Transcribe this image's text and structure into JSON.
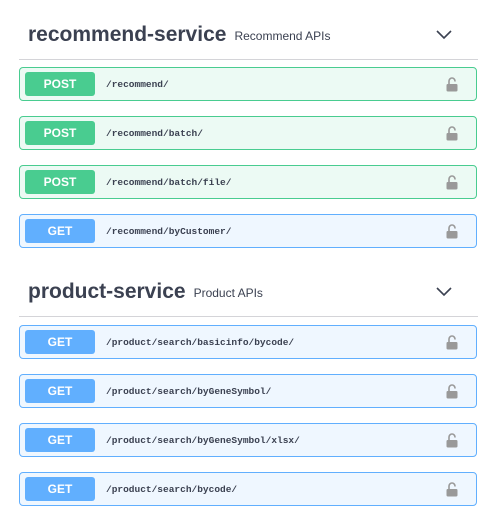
{
  "sections": [
    {
      "title": "recommend-service",
      "description": "Recommend APIs",
      "operations": [
        {
          "method": "POST",
          "path": "/recommend/"
        },
        {
          "method": "POST",
          "path": "/recommend/batch/"
        },
        {
          "method": "POST",
          "path": "/recommend/batch/file/"
        },
        {
          "method": "GET",
          "path": "/recommend/byCustomer/"
        }
      ]
    },
    {
      "title": "product-service",
      "description": "Product APIs",
      "operations": [
        {
          "method": "GET",
          "path": "/product/search/basicinfo/bycode/"
        },
        {
          "method": "GET",
          "path": "/product/search/byGeneSymbol/"
        },
        {
          "method": "GET",
          "path": "/product/search/byGeneSymbol/xlsx/"
        },
        {
          "method": "GET",
          "path": "/product/search/bycode/"
        }
      ]
    }
  ],
  "colors": {
    "post": "#49cc90",
    "get": "#61affe",
    "text": "#3b4151"
  },
  "icons": {
    "collapse": "chevron-down-icon",
    "auth": "unlock-icon"
  }
}
